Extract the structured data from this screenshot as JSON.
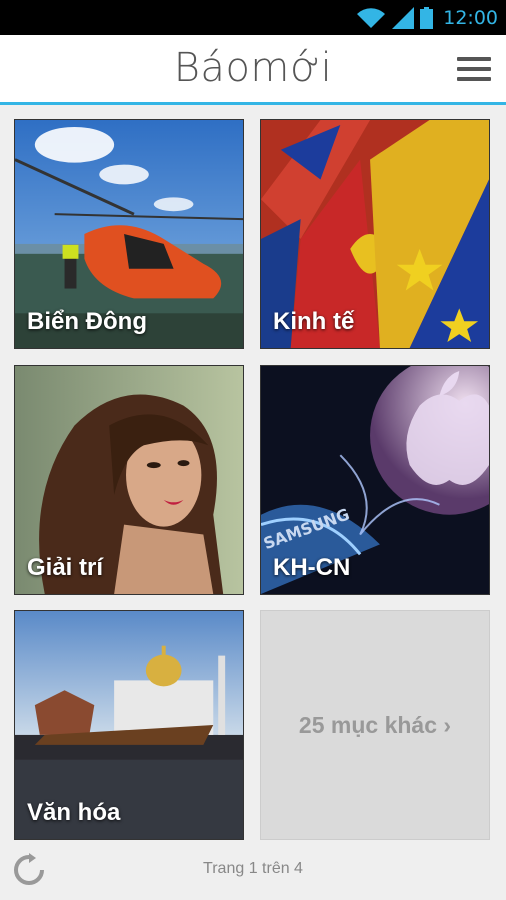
{
  "status_bar": {
    "time": "12:00",
    "icons": [
      "wifi-icon",
      "signal-icon",
      "battery-icon"
    ]
  },
  "header": {
    "title": "Báomới",
    "menu_icon": "menu-icon",
    "accent": "#33b5e5"
  },
  "tiles": [
    {
      "label": "Biển Đông"
    },
    {
      "label": "Kinh tế"
    },
    {
      "label": "Giải trí"
    },
    {
      "label": "KH-CN"
    },
    {
      "label": "Văn hóa"
    }
  ],
  "more": {
    "label": "25 mục khác ›"
  },
  "footer": {
    "page_text": "Trang 1 trên 4",
    "refresh_icon": "refresh-icon"
  }
}
